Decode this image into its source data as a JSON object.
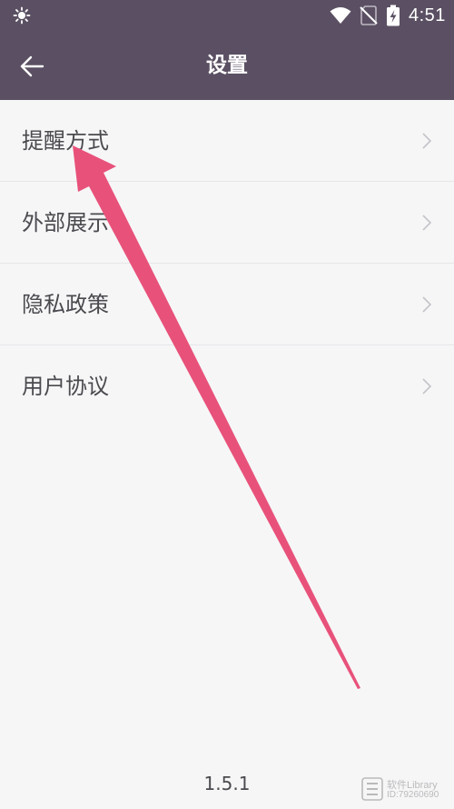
{
  "status_bar": {
    "time": "4:51",
    "icons": [
      "sun-icon",
      "wifi-icon",
      "no-sim-icon",
      "battery-charging-icon"
    ]
  },
  "app_bar": {
    "title": "设置",
    "back_icon": "arrow-left-icon"
  },
  "settings": {
    "items": [
      {
        "label": "提醒方式"
      },
      {
        "label": "外部展示"
      },
      {
        "label": "隐私政策"
      },
      {
        "label": "用户协议"
      }
    ]
  },
  "footer": {
    "version": "1.5.1"
  },
  "watermark": {
    "line1": "软件Library",
    "line2": "ID:79260690"
  },
  "colors": {
    "bar": "#5b5063",
    "background": "#f6f6f7",
    "arrow": "#e8527a",
    "text": "#4a4a4f"
  }
}
